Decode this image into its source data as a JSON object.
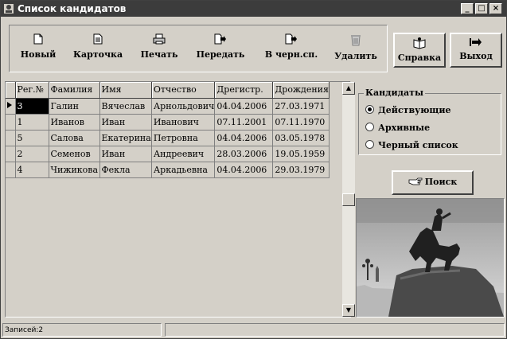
{
  "window": {
    "title": "Список кандидатов",
    "controls": [
      "_",
      "□",
      "×"
    ]
  },
  "toolbar": {
    "buttons": [
      {
        "label": "Новый",
        "icon": "new-document-icon"
      },
      {
        "label": "Карточка",
        "icon": "card-document-icon"
      },
      {
        "label": "Печать",
        "icon": "printer-icon"
      },
      {
        "label": "Передать",
        "icon": "transfer-icon"
      },
      {
        "label": "В черн.сп.",
        "icon": "blacklist-icon"
      },
      {
        "label": "Удалить",
        "icon": "recycle-bin-icon"
      }
    ],
    "help_label": "Справка",
    "exit_label": "Выход"
  },
  "grid": {
    "columns": [
      "Рег.№",
      "Фамилия",
      "Имя",
      "Отчество",
      "Дрегистр.",
      "Дрождения"
    ],
    "rows": [
      [
        "3",
        "Галин",
        "Вячеслав",
        "Арнольдович",
        "04.04.2006",
        "27.03.1971"
      ],
      [
        "1",
        "Иванов",
        "Иван",
        "Иванович",
        "07.11.2001",
        "07.11.1970"
      ],
      [
        "5",
        "Салова",
        "Екатерина",
        "Петровна",
        "04.04.2006",
        "03.05.1978"
      ],
      [
        "2",
        "Семенов",
        "Иван",
        "Андреевич",
        "28.03.2006",
        "19.05.1959"
      ],
      [
        "4",
        "Чижикова",
        "Фекла",
        "Аркадьевна",
        "04.04.2006",
        "29.03.1979"
      ]
    ],
    "selected_row": 0
  },
  "candidates": {
    "legend": "Кандидаты",
    "options": [
      "Действующие",
      "Архивные",
      "Черный список"
    ],
    "selected": 0
  },
  "search_label": "Поиск",
  "status": {
    "records": "Записей:2"
  }
}
